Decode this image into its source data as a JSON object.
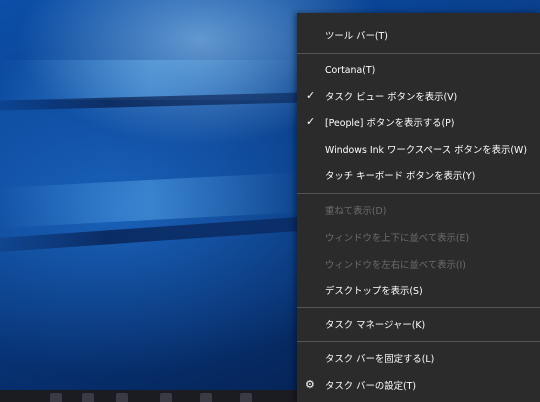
{
  "context_menu": {
    "items": [
      {
        "label": "ツール バー(T)",
        "enabled": true
      },
      {
        "label": "Cortana(T)",
        "enabled": true
      },
      {
        "label": "タスク ビュー ボタンを表示(V)",
        "enabled": true,
        "checked": true
      },
      {
        "label": "[People] ボタンを表示する(P)",
        "enabled": true,
        "checked": true
      },
      {
        "label": "Windows Ink ワークスペース ボタンを表示(W)",
        "enabled": true
      },
      {
        "label": "タッチ キーボード ボタンを表示(Y)",
        "enabled": true
      },
      {
        "label": "重ねて表示(D)",
        "enabled": false
      },
      {
        "label": "ウィンドウを上下に並べて表示(E)",
        "enabled": false
      },
      {
        "label": "ウィンドウを左右に並べて表示(I)",
        "enabled": false
      },
      {
        "label": "デスクトップを表示(S)",
        "enabled": true
      },
      {
        "label": "タスク マネージャー(K)",
        "enabled": true
      },
      {
        "label": "タスク バーを固定する(L)",
        "enabled": true
      },
      {
        "label": "タスク バーの設定(T)",
        "enabled": true,
        "icon": "gear-icon"
      }
    ],
    "check_glyph": "✓",
    "gear_glyph": "⚙"
  },
  "colors": {
    "menu_background": "#2b2b2b",
    "menu_text": "#ffffff",
    "menu_disabled_text": "#6d6d6d",
    "separator": "#555555"
  }
}
